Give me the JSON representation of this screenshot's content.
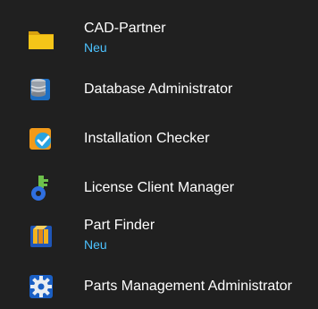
{
  "start_menu": {
    "folder": {
      "label": "CAD-Partner",
      "badge": "Neu",
      "icon": "folder-icon"
    },
    "items": [
      {
        "label": "Database Administrator",
        "icon": "database-icon"
      },
      {
        "label": "Installation Checker",
        "icon": "installation-checker-icon"
      },
      {
        "label": "License Client Manager",
        "icon": "key-icon"
      },
      {
        "label": "Part Finder",
        "badge": "Neu",
        "icon": "part-finder-icon"
      },
      {
        "label": "Parts Management Administrator",
        "icon": "gear-icon"
      }
    ]
  },
  "colors": {
    "background": "#202020",
    "text": "#ffffff",
    "badge": "#4cc2ff",
    "folder": "#f5c518"
  }
}
